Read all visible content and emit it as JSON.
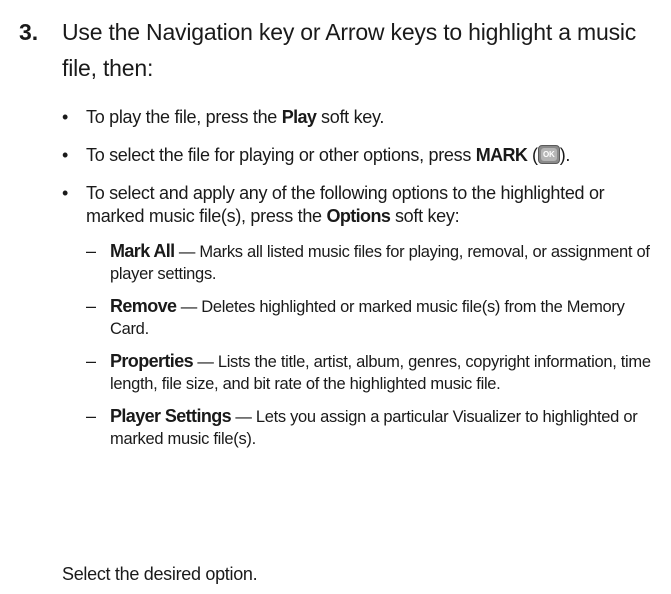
{
  "step": {
    "number": "3.",
    "text": "Use the Navigation key or Arrow keys to highlight a music file, then:"
  },
  "bullets": [
    {
      "pre": "To play the file, press the ",
      "bold": "Play",
      "post": " soft key."
    },
    {
      "pre": "To select the file for playing or other options, press ",
      "bold": "MARK",
      "post_before_icon": " (",
      "post": ")."
    },
    {
      "pre": "To select and apply any of the following options to the highlighted or marked music file(s), press the ",
      "bold": "Options",
      "post": " soft key:"
    }
  ],
  "ok_key": {
    "icon": "ok-key-icon",
    "label": "OK"
  },
  "options": [
    {
      "term": "Mark All",
      "desc": " — Marks all listed music files for playing, removal, or assignment of player settings."
    },
    {
      "term": "Remove",
      "desc": " — Deletes highlighted or marked music file(s) from the Memory Card."
    },
    {
      "term": "Properties",
      "desc": " — Lists the title, artist, album, genres, copyright information, time length, file size, and bit rate of the highlighted music file."
    },
    {
      "term": "Player Settings",
      "desc": " — Lets you assign a particular Visualizer to highlighted or marked music file(s)."
    }
  ],
  "final": "Select the desired option.",
  "symbols": {
    "bullet": "•",
    "dash": "–"
  }
}
